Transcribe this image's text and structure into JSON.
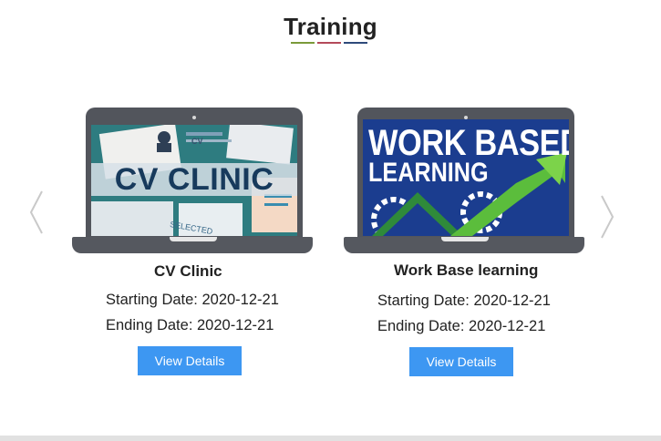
{
  "section": {
    "title": "Training",
    "underline_colors": [
      "#7a9a3a",
      "#b44a5a",
      "#2e4a7a"
    ]
  },
  "carousel": {
    "prev_icon": "chevron-left-icon",
    "next_icon": "chevron-right-icon",
    "cards": [
      {
        "image_text": "CV CLINIC",
        "image_small_text": "CV",
        "image_stamp_text": "SELECTED",
        "title": "CV Clinic",
        "starting_date": "Starting Date: 2020-12-21",
        "ending_date": "Ending Date: 2020-12-21",
        "button_label": "View Details"
      },
      {
        "image_text_line1": "WORK BASED",
        "image_text_line2": "LEARNING",
        "title": "Work Base learning",
        "starting_date": "Starting Date: 2020-12-21",
        "ending_date": "Ending Date: 2020-12-21",
        "button_label": "View Details"
      }
    ]
  },
  "colors": {
    "button": "#3d97f2",
    "laptop": "#52555c"
  }
}
